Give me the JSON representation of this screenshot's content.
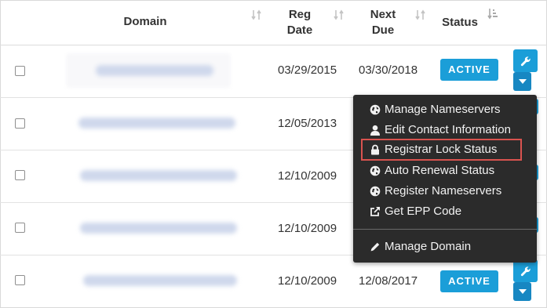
{
  "columns": {
    "domain": "Domain",
    "reg_date_line1": "Reg",
    "reg_date_line2": "Date",
    "next_due_line1": "Next",
    "next_due_line2": "Due",
    "status": "Status"
  },
  "rows": [
    {
      "reg_date": "03/29/2015",
      "next_due": "03/30/2018",
      "status": "ACTIVE"
    },
    {
      "reg_date": "12/05/2013"
    },
    {
      "reg_date": "12/10/2009"
    },
    {
      "reg_date": "12/10/2009"
    },
    {
      "reg_date": "12/10/2009",
      "next_due": "12/08/2017",
      "status": "ACTIVE"
    }
  ],
  "menu": {
    "items": [
      {
        "label": "Manage Nameservers",
        "icon": "globe-icon"
      },
      {
        "label": "Edit Contact Information",
        "icon": "user-icon"
      },
      {
        "label": "Registrar Lock Status",
        "icon": "lock-icon"
      },
      {
        "label": "Auto Renewal Status",
        "icon": "globe-icon"
      },
      {
        "label": "Register Nameservers",
        "icon": "globe-icon"
      },
      {
        "label": "Get EPP Code",
        "icon": "external-link-icon"
      }
    ],
    "footer_item": {
      "label": "Manage Domain",
      "icon": "pencil-icon"
    }
  },
  "colors": {
    "accent": "#1b9ed8",
    "menu_bg": "#2b2b2b",
    "highlight": "#d9534f"
  }
}
